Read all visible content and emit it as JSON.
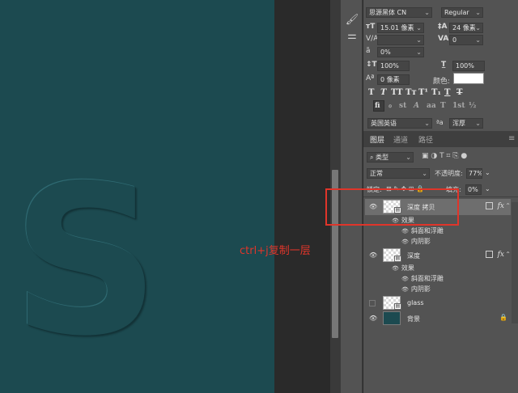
{
  "canvas": {
    "letter": "S",
    "background_color": "#1c4a50"
  },
  "tools": {
    "icons": [
      "brush-icon",
      "adjust-icon"
    ]
  },
  "character": {
    "font_family": "思源黑体 CN",
    "font_style": "Regular",
    "font_size": "15.01 像素",
    "leading": "24 像素",
    "kerning": "",
    "tracking": "0",
    "vertical_scale_pct": "0%",
    "scale_vertical": "100%",
    "scale_horizontal": "100%",
    "baseline_shift": "0 像素",
    "color_label": "颜色:",
    "color_value": "#ffffff",
    "style_buttons": [
      "T",
      "T",
      "TT",
      "Tт",
      "T¹",
      "T₁",
      "T",
      "Ŧ"
    ],
    "opentype_buttons": [
      "fi",
      "ℴ",
      "st",
      "A",
      "aa",
      "T",
      "1st",
      "½"
    ],
    "language": "英国英语",
    "aa_label": "ªa",
    "antialias": "浑厚"
  },
  "layers_panel": {
    "tabs": [
      "图层",
      "通道",
      "路径"
    ],
    "filter_label": "类型",
    "blend_mode": "正常",
    "opacity_label": "不透明度:",
    "opacity_value": "77%",
    "lock_label": "锁定:",
    "fill_label": "填充:",
    "fill_value": "0%",
    "layers": [
      {
        "name": "深度 拷贝",
        "selected": true,
        "effects_label": "效果",
        "effects": [
          "斜面和浮雕",
          "内阴影"
        ]
      },
      {
        "name": "深度",
        "selected": false,
        "effects_label": "效果",
        "effects": [
          "斜面和浮雕",
          "内阴影"
        ]
      },
      {
        "name": "glass",
        "selected": false
      },
      {
        "name": "背景",
        "selected": false
      }
    ]
  },
  "annotation": {
    "text": "ctrl+j复制一层",
    "color": "#e0352a"
  }
}
